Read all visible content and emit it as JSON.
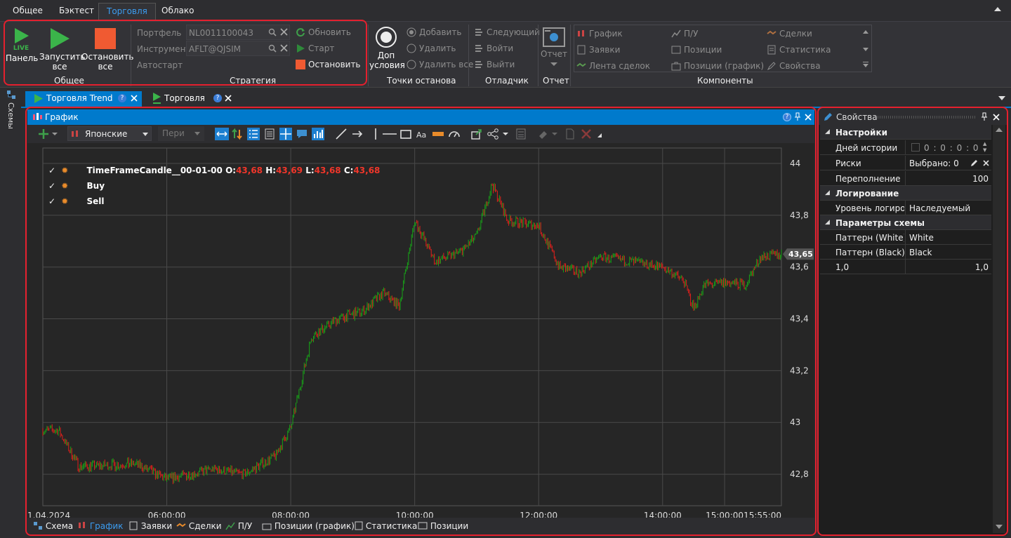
{
  "menu_tabs": {
    "general": "Общее",
    "backtest": "Бэктест",
    "trading": "Торговля",
    "cloud": "Облако"
  },
  "ribbon": {
    "general": {
      "panel": "Панель",
      "live": "LIVE",
      "start_all_1": "Запустить",
      "start_all_2": "все",
      "stop_all_1": "Остановить",
      "stop_all_2": "все",
      "group": "Общее"
    },
    "strategy": {
      "portfolio_label": "Портфель",
      "portfolio_value": "NL0011100043",
      "instrument_label": "Инструмент",
      "instrument_value": "AFLT@QJSIM",
      "autostart_label": "Автостарт",
      "refresh": "Обновить",
      "start": "Старт",
      "stop": "Остановить",
      "group": "Стратегия"
    },
    "breakpoints": {
      "extra_1": "Доп",
      "extra_2": "условия",
      "add": "Добавить",
      "remove": "Удалить",
      "remove_all": "Удалить все",
      "group": "Точки останова"
    },
    "debugger": {
      "next": "Следующий",
      "step_in": "Войти",
      "step_out": "Выйти",
      "group": "Отладчик"
    },
    "report": {
      "label": "Отчет",
      "group": "Отчет"
    },
    "components": {
      "chart": "График",
      "pnl": "П/У",
      "trades": "Сделки",
      "orders": "Заявки",
      "positions": "Позиции",
      "statistics": "Статистика",
      "tape": "Лента сделок",
      "positions_chart": "Позиции (график)",
      "properties": "Свойства",
      "group": "Компоненты"
    }
  },
  "left_sidebar": {
    "schemes": "Схемы"
  },
  "doc_tabs": {
    "trend": "Торговля Trend",
    "trading": "Торговля",
    "help": "?"
  },
  "chart_panel": {
    "title": "График",
    "toolbar": {
      "candle_type": "Японские",
      "period_placeholder": "Пери"
    },
    "bottom_tabs": {
      "scheme": "Схема",
      "chart": "График",
      "orders": "Заявки",
      "trades": "Сделки",
      "pnl": "П/У",
      "positions_chart": "Позиции (график)",
      "statistics": "Статистика",
      "positions": "Позиции"
    }
  },
  "chart_data": {
    "type": "candlestick",
    "legend": [
      {
        "name": "TimeFrameCandle__00-01-00",
        "o_label": "O:",
        "o": "43,68",
        "h_label": "H:",
        "h": "43,69",
        "l_label": "L:",
        "l": "43,68",
        "c_label": "C:",
        "c": "43,68"
      },
      {
        "name": "Buy"
      },
      {
        "name": "Sell"
      }
    ],
    "y_ticks": [
      "44",
      "43,8",
      "43,6",
      "43,4",
      "43,2",
      "43",
      "42,8"
    ],
    "y_tick_values": [
      44,
      43.8,
      43.6,
      43.4,
      43.2,
      43,
      42.8
    ],
    "x_ticks": [
      "1.04.2024",
      "06:00:00",
      "08:00:00",
      "10:00:00",
      "12:00:00",
      "14:00:00",
      "15:00:00",
      "15:55:00"
    ],
    "ylim": [
      42.7,
      44.0
    ],
    "last_price": "43,65",
    "price_path": [
      {
        "t": "04:00",
        "p": 42.97
      },
      {
        "t": "04:15",
        "p": 42.97
      },
      {
        "t": "04:35",
        "p": 42.83
      },
      {
        "t": "05:30",
        "p": 42.84
      },
      {
        "t": "06:00",
        "p": 42.78
      },
      {
        "t": "06:45",
        "p": 42.82
      },
      {
        "t": "07:15",
        "p": 42.8
      },
      {
        "t": "07:45",
        "p": 42.87
      },
      {
        "t": "08:00",
        "p": 42.98
      },
      {
        "t": "08:20",
        "p": 43.33
      },
      {
        "t": "08:45",
        "p": 43.4
      },
      {
        "t": "09:10",
        "p": 43.43
      },
      {
        "t": "09:30",
        "p": 43.5
      },
      {
        "t": "09:45",
        "p": 43.45
      },
      {
        "t": "10:00",
        "p": 43.78
      },
      {
        "t": "10:20",
        "p": 43.62
      },
      {
        "t": "10:45",
        "p": 43.66
      },
      {
        "t": "11:00",
        "p": 43.72
      },
      {
        "t": "11:15",
        "p": 43.92
      },
      {
        "t": "11:30",
        "p": 43.78
      },
      {
        "t": "12:00",
        "p": 43.76
      },
      {
        "t": "12:20",
        "p": 43.6
      },
      {
        "t": "12:40",
        "p": 43.58
      },
      {
        "t": "13:00",
        "p": 43.64
      },
      {
        "t": "13:30",
        "p": 43.62
      },
      {
        "t": "14:00",
        "p": 43.6
      },
      {
        "t": "14:20",
        "p": 43.55
      },
      {
        "t": "14:30",
        "p": 43.44
      },
      {
        "t": "14:40",
        "p": 43.53
      },
      {
        "t": "15:00",
        "p": 43.54
      },
      {
        "t": "15:20",
        "p": 43.53
      },
      {
        "t": "15:35",
        "p": 43.64
      },
      {
        "t": "15:55",
        "p": 43.65
      }
    ],
    "grid": true,
    "up_color": "#17a317",
    "down_color": "#e0201b"
  },
  "properties": {
    "title": "Свойства",
    "sections": [
      {
        "name": "Настройки",
        "rows": [
          {
            "key": "Дней истории",
            "value": "0 : 0 : 0 : 0"
          },
          {
            "key": "Риски",
            "value": "Выбрано: 0"
          },
          {
            "key": "Переполнение",
            "value": "100"
          }
        ]
      },
      {
        "name": "Логирование",
        "rows": [
          {
            "key": "Уровень логиро...",
            "value": "Наследуемый"
          }
        ]
      },
      {
        "name": "Параметры схемы",
        "rows": [
          {
            "key": "Паттерн (White)",
            "value": "White"
          },
          {
            "key": "Паттерн (Black)",
            "value": "Black"
          },
          {
            "key": "1,0",
            "value": "1,0"
          }
        ]
      }
    ]
  },
  "colors": {
    "accent": "#007acc",
    "highlight": "#e5202e",
    "background": "#2d2d30"
  }
}
